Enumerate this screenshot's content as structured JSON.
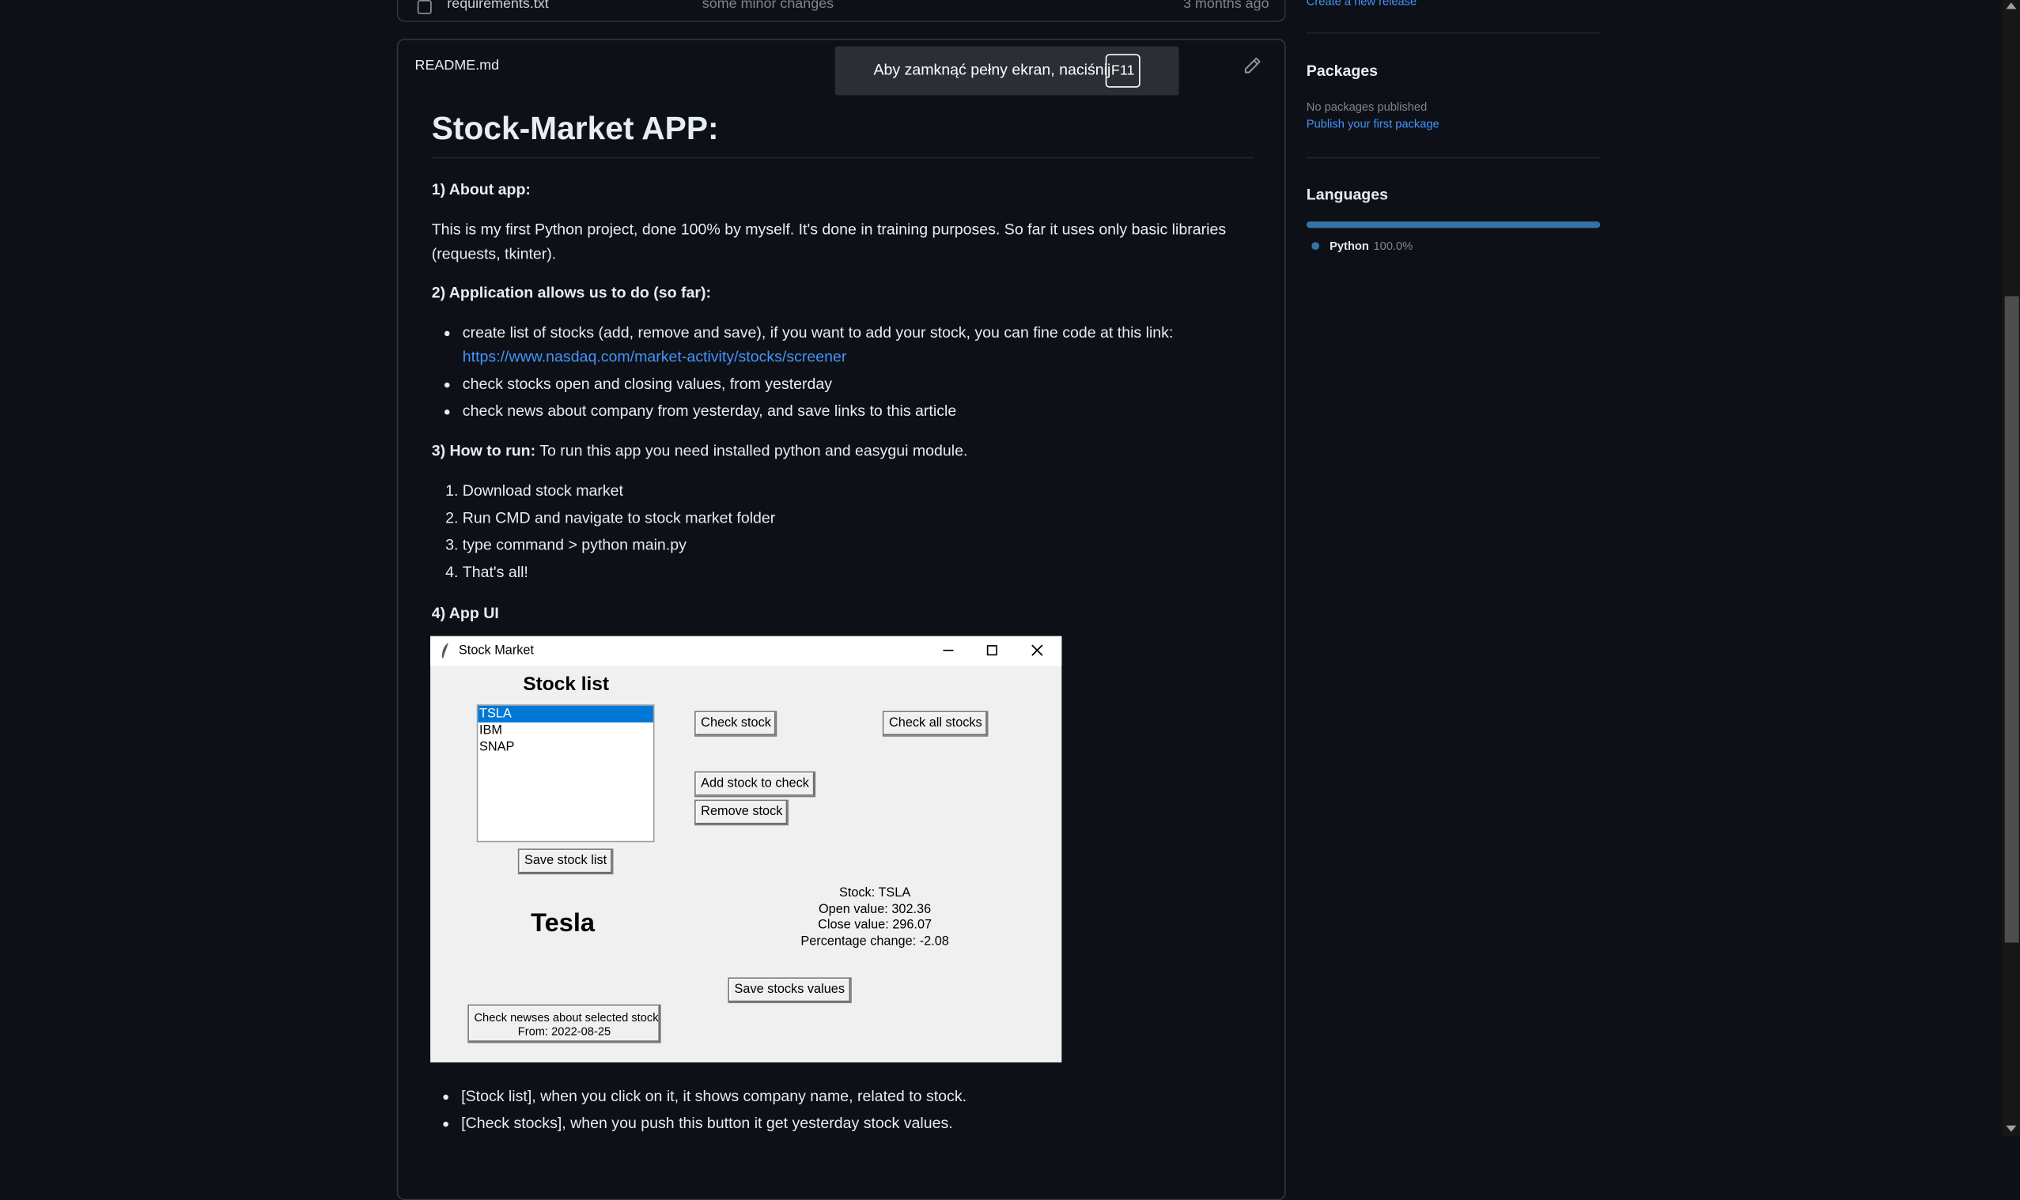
{
  "file_list": {
    "row": {
      "name": "requirements.txt",
      "commit": "some minor changes",
      "age": "3 months ago"
    }
  },
  "readme": {
    "filename": "README.md",
    "fullscreen_toast": {
      "message": "Aby zamknąć pełny ekran, naciśnij",
      "key": "F11"
    },
    "title": "Stock-Market APP:",
    "s1_heading": "1) About app:",
    "s1_text": "This is my first Python project, done 100% by myself. It's done in training purposes. So far it uses only basic libraries (requests, tkinter).",
    "s2_heading": "2) Application allows us to do (so far):",
    "s2_items": [
      {
        "text": "create list of stocks (add, remove and save), if you want to add your stock, you can fine code at this link:",
        "link": "https://www.nasdaq.com/market-activity/stocks/screener"
      },
      {
        "text": "check stocks open and closing values, from yesterday"
      },
      {
        "text": "check news about company from yesterday, and save links to this article"
      }
    ],
    "s3_heading": "3) How to run:",
    "s3_text": "To run this app you need installed python and easygui module.",
    "s3_steps": [
      "Download stock market",
      "Run CMD and navigate to stock market folder",
      "type command > python main.py",
      "That's all!"
    ],
    "s4_heading": "4) App UI",
    "s4_items": [
      "[Stock list], when you click on it, it shows company name, related to stock.",
      "[Check stocks], when you push this button it get yesterday stock values."
    ]
  },
  "app_ui": {
    "window_title": "Stock Market",
    "stock_list_label": "Stock list",
    "stocks": [
      "TSLA",
      "IBM",
      "SNAP"
    ],
    "selected_stock": "TSLA",
    "buttons": {
      "check_stock": "Check stock",
      "check_all": "Check all stocks",
      "add_stock": "Add stock to check",
      "remove_stock": "Remove stock",
      "save_list": "Save stock list",
      "save_values": "Save stocks values",
      "news_line1": "Check newses about selected stock",
      "news_line2": "From: 2022-08-25"
    },
    "company_name": "Tesla",
    "info": {
      "stock": "Stock: TSLA",
      "open": "Open value: 302.36",
      "close": "Close value: 296.07",
      "change": "Percentage change: -2.08"
    }
  },
  "sidebar": {
    "releases_link": "Create a new release",
    "packages": {
      "heading": "Packages",
      "none_text": "No packages published",
      "publish_link": "Publish your first package"
    },
    "languages": {
      "heading": "Languages",
      "items": [
        {
          "name": "Python",
          "percent": "100.0%",
          "fraction": 1.0,
          "color": "#3572A5"
        }
      ]
    }
  },
  "colors": {
    "background": "#0d1117",
    "link": "#4493f8",
    "python": "#3572A5"
  }
}
